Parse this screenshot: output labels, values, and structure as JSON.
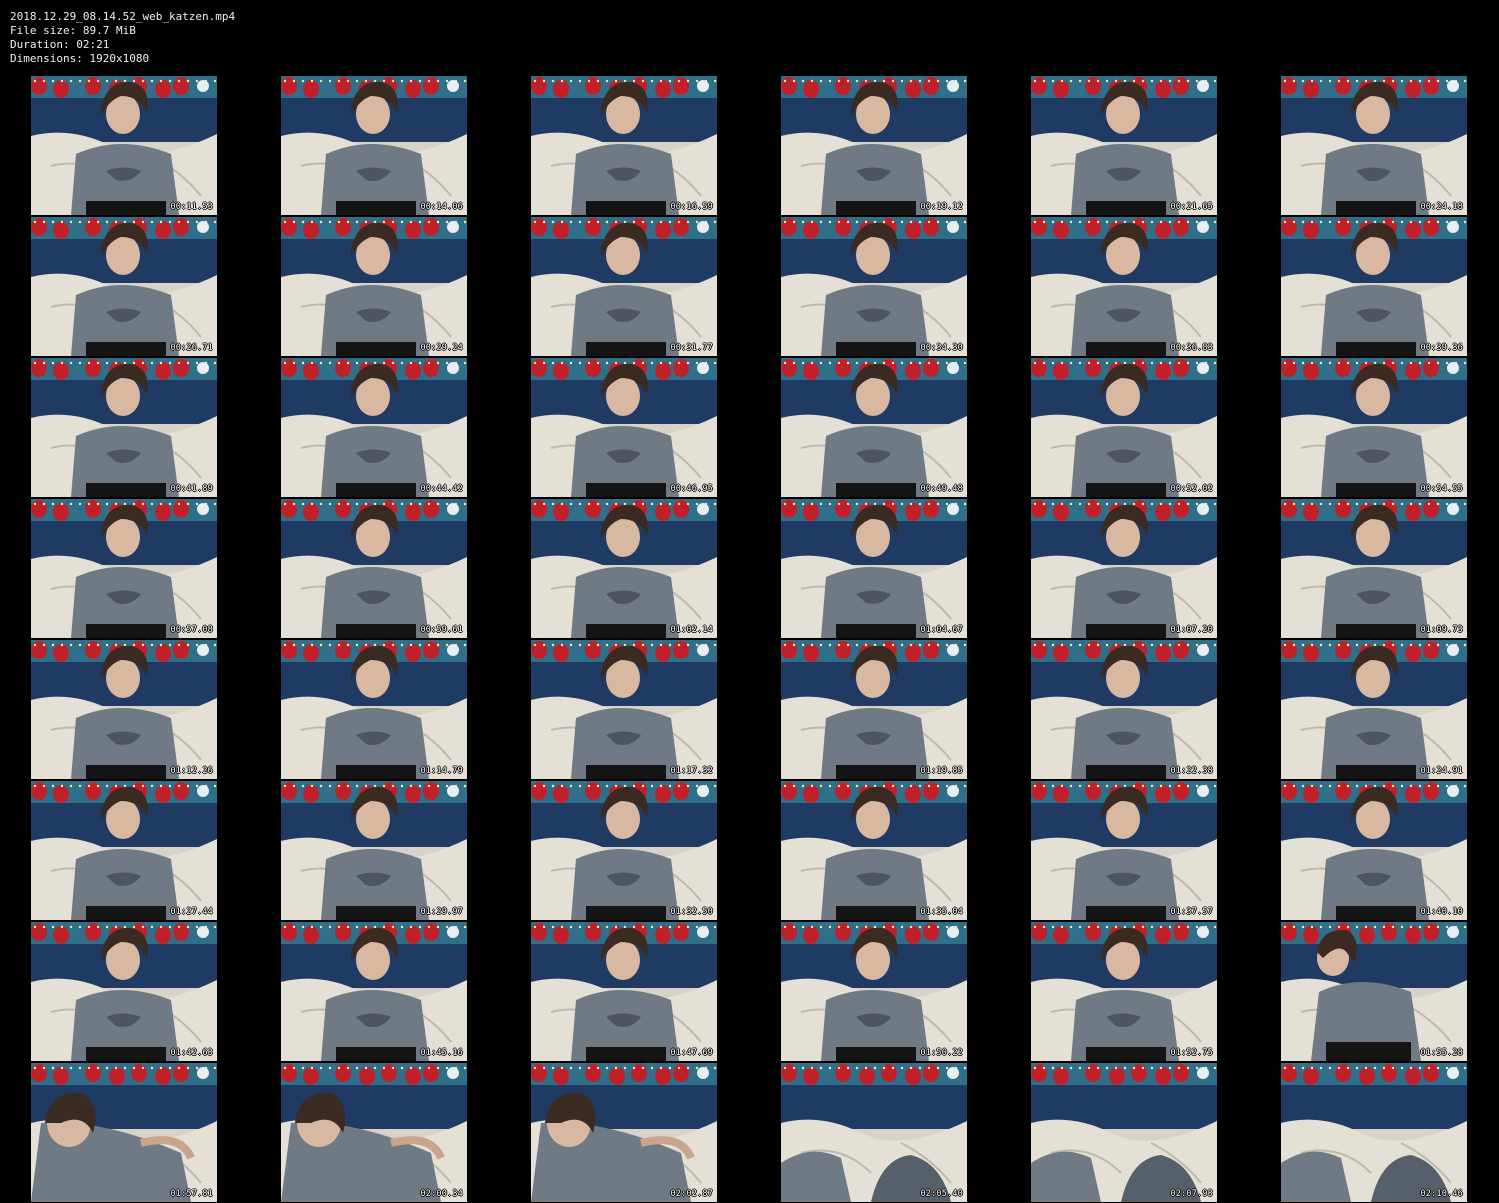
{
  "file_info": {
    "filename": "2018.12.29_08.14.52_web_katzen.mp4",
    "file_size": "File size: 89.7 MiB",
    "duration": "Duration: 02:21",
    "dimensions": "Dimensions: 1920x1080"
  },
  "colors": {
    "background": "#000000",
    "text": "#ffffff",
    "sofa": "#1f3a63",
    "blanket": "#d8d3c8",
    "shirt": "#6f7a84",
    "hair": "#3a2a22",
    "decor_red": "#c0202a"
  },
  "thumbnails": [
    {
      "timestamp": "00:11.53",
      "scene": "seated"
    },
    {
      "timestamp": "00:14.06",
      "scene": "seated"
    },
    {
      "timestamp": "00:16.59",
      "scene": "seated"
    },
    {
      "timestamp": "00:19.12",
      "scene": "seated"
    },
    {
      "timestamp": "00:21.65",
      "scene": "seated"
    },
    {
      "timestamp": "00:24.18",
      "scene": "seated"
    },
    {
      "timestamp": "00:26.71",
      "scene": "seated"
    },
    {
      "timestamp": "00:29.24",
      "scene": "seated"
    },
    {
      "timestamp": "00:31.77",
      "scene": "seated"
    },
    {
      "timestamp": "00:34.30",
      "scene": "seated"
    },
    {
      "timestamp": "00:36.83",
      "scene": "seated"
    },
    {
      "timestamp": "00:39.36",
      "scene": "seated"
    },
    {
      "timestamp": "00:41.89",
      "scene": "seated"
    },
    {
      "timestamp": "00:44.42",
      "scene": "seated"
    },
    {
      "timestamp": "00:46.95",
      "scene": "seated"
    },
    {
      "timestamp": "00:49.48",
      "scene": "seated"
    },
    {
      "timestamp": "00:52.02",
      "scene": "seated"
    },
    {
      "timestamp": "00:54.55",
      "scene": "seated"
    },
    {
      "timestamp": "00:57.08",
      "scene": "seated"
    },
    {
      "timestamp": "00:59.61",
      "scene": "seated"
    },
    {
      "timestamp": "01:02.14",
      "scene": "seated"
    },
    {
      "timestamp": "01:04.67",
      "scene": "seated"
    },
    {
      "timestamp": "01:07.20",
      "scene": "seated"
    },
    {
      "timestamp": "01:09.73",
      "scene": "seated"
    },
    {
      "timestamp": "01:12.26",
      "scene": "seated"
    },
    {
      "timestamp": "01:14.79",
      "scene": "seated"
    },
    {
      "timestamp": "01:17.32",
      "scene": "seated"
    },
    {
      "timestamp": "01:19.85",
      "scene": "seated"
    },
    {
      "timestamp": "01:22.38",
      "scene": "seated"
    },
    {
      "timestamp": "01:24.91",
      "scene": "seated"
    },
    {
      "timestamp": "01:27.44",
      "scene": "seated"
    },
    {
      "timestamp": "01:29.97",
      "scene": "seated"
    },
    {
      "timestamp": "01:32.50",
      "scene": "seated"
    },
    {
      "timestamp": "01:35.04",
      "scene": "seated"
    },
    {
      "timestamp": "01:37.57",
      "scene": "seated"
    },
    {
      "timestamp": "01:40.10",
      "scene": "seated"
    },
    {
      "timestamp": "01:42.63",
      "scene": "seated"
    },
    {
      "timestamp": "01:45.16",
      "scene": "seated"
    },
    {
      "timestamp": "01:47.69",
      "scene": "seated"
    },
    {
      "timestamp": "01:50.22",
      "scene": "seated"
    },
    {
      "timestamp": "01:52.75",
      "scene": "seated"
    },
    {
      "timestamp": "01:55.28",
      "scene": "turned"
    },
    {
      "timestamp": "01:57.81",
      "scene": "leaning"
    },
    {
      "timestamp": "02:00.34",
      "scene": "leaning"
    },
    {
      "timestamp": "02:02.87",
      "scene": "leaning"
    },
    {
      "timestamp": "02:05.40",
      "scene": "empty"
    },
    {
      "timestamp": "02:07.93",
      "scene": "empty"
    },
    {
      "timestamp": "02:10.46",
      "scene": "empty"
    }
  ]
}
